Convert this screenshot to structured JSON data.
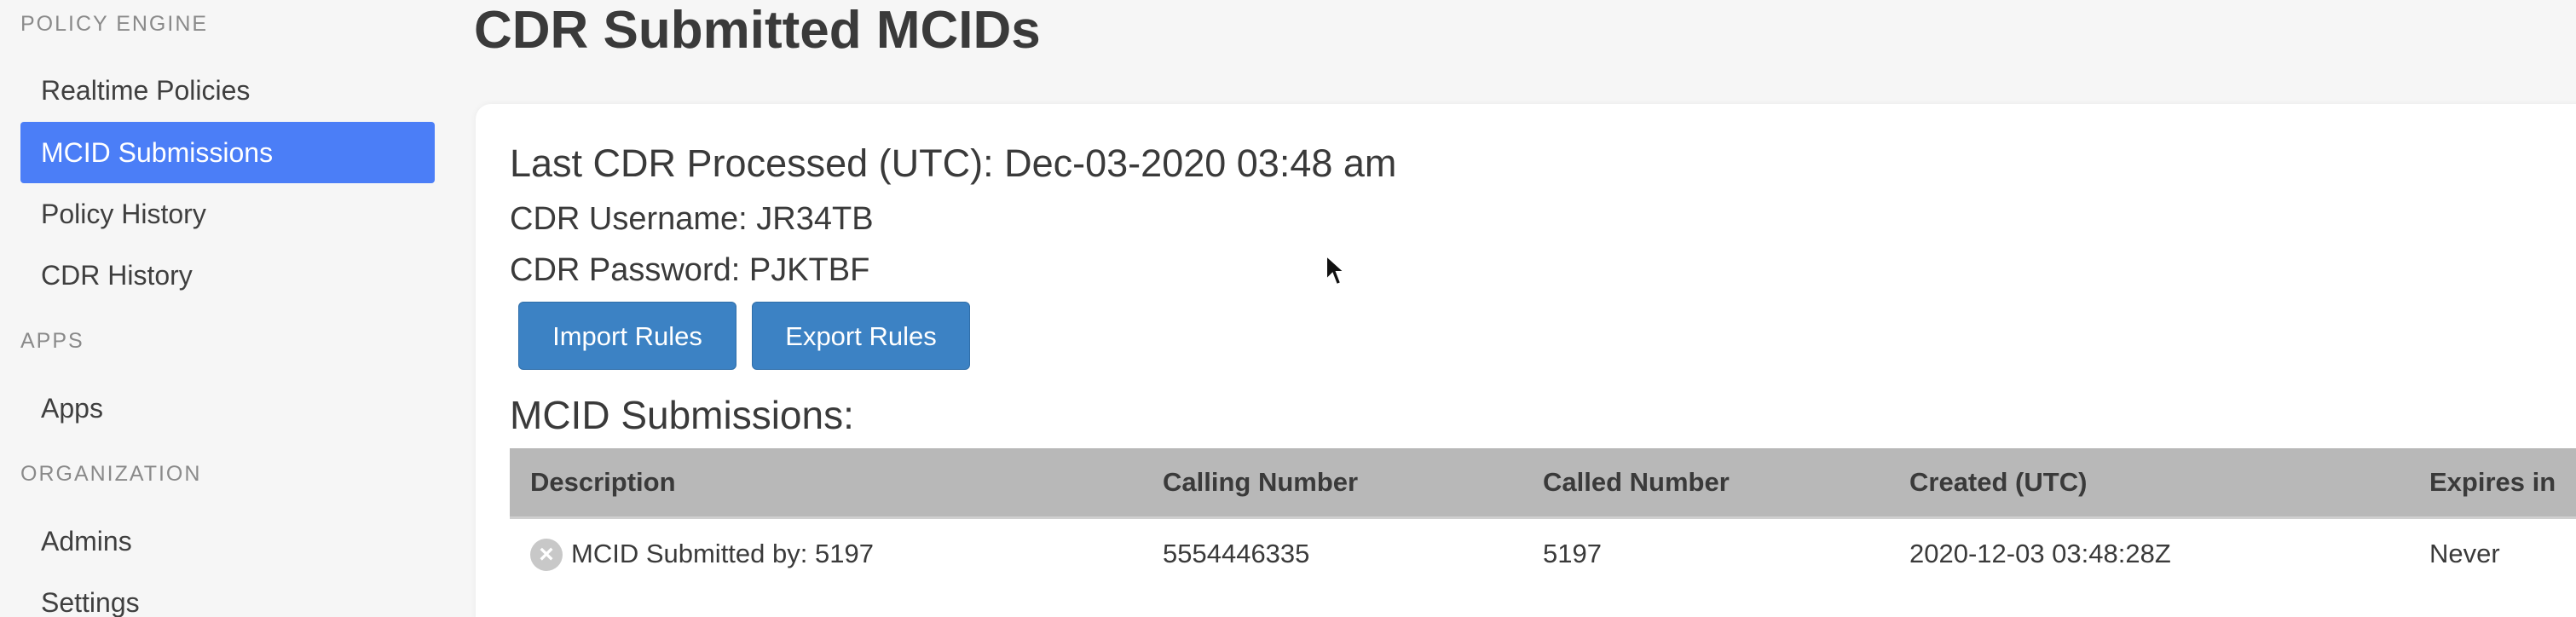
{
  "sidebar": {
    "sections": [
      {
        "header": "POLICY ENGINE",
        "items": [
          "Realtime Policies",
          "MCID Submissions",
          "Policy History",
          "CDR History"
        ]
      },
      {
        "header": "APPS",
        "items": [
          "Apps"
        ]
      },
      {
        "header": "ORGANIZATION",
        "items": [
          "Admins",
          "Settings"
        ]
      }
    ],
    "active_item": "MCID Submissions"
  },
  "main": {
    "title": "CDR Submitted MCIDs",
    "last_cdr": "Last CDR Processed (UTC): Dec-03-2020 03:48 am",
    "cdr_username": "CDR Username: JR34TB",
    "cdr_password": "CDR Password: PJKTBF",
    "buttons": {
      "import": "Import Rules",
      "export": "Export Rules"
    },
    "submissions_heading": "MCID Submissions:",
    "table": {
      "headers": [
        "Description",
        "Calling Number",
        "Called Number",
        "Created (UTC)",
        "Expires in"
      ],
      "rows": [
        [
          "MCID Submitted by: 5197",
          "5554446335",
          "5197",
          "2020-12-03 03:48:28Z",
          "Never"
        ]
      ]
    }
  },
  "colors": {
    "active_nav": "#4b7ef7",
    "button": "#3c82c4",
    "table_header": "#b8b8b8"
  },
  "icons": [
    "remove-icon",
    "mouse-cursor-icon"
  ]
}
